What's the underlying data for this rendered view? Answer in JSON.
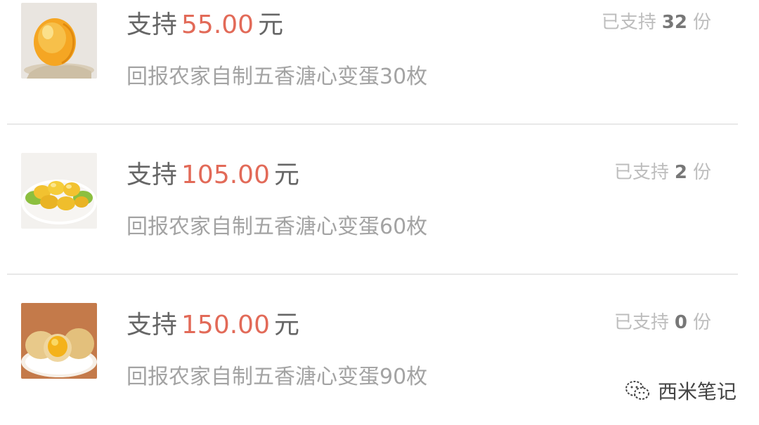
{
  "rewards": [
    {
      "prefix": "支持",
      "amount": "55.00",
      "unit": "元",
      "backers_prefix": "已支持",
      "backers_count": "32",
      "backers_suffix": "份",
      "description": "回报农家自制五香溏心变蛋30枚",
      "thumb_icon": "egg-yolk-image"
    },
    {
      "prefix": "支持",
      "amount": "105.00",
      "unit": "元",
      "backers_prefix": "已支持",
      "backers_count": "2",
      "backers_suffix": "份",
      "description": "回报农家自制五香溏心变蛋60枚",
      "thumb_icon": "egg-plate-image"
    },
    {
      "prefix": "支持",
      "amount": "150.00",
      "unit": "元",
      "backers_prefix": "已支持",
      "backers_count": "0",
      "backers_suffix": "份",
      "description": "回报农家自制五香溏心变蛋90枚",
      "thumb_icon": "egg-halves-image"
    }
  ],
  "watermark": {
    "text": "西米笔记",
    "icon": "wechat-icon"
  },
  "colors": {
    "price": "#e26a58",
    "text": "#666666",
    "muted": "#a3a3a3",
    "divider": "#e8e8e8"
  }
}
